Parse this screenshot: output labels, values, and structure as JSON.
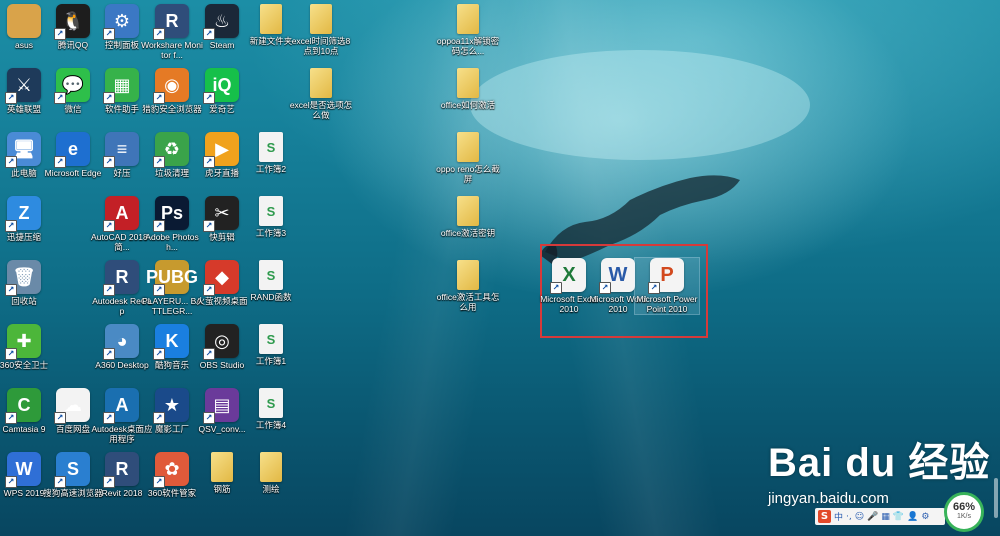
{
  "desktop": {
    "icons": [
      {
        "label": "asus",
        "glyph": "",
        "color": "#d9a34a",
        "type": "user"
      },
      {
        "label": "腾讯QQ",
        "glyph": "🐧",
        "color": "#1d1d1d",
        "type": "app"
      },
      {
        "label": "控制面板",
        "glyph": "⚙",
        "color": "#3b78c4",
        "type": "app"
      },
      {
        "label": "Workshare Monitor f...",
        "glyph": "R",
        "color": "#2f4d7a",
        "type": "app"
      },
      {
        "label": "Steam",
        "glyph": "♨",
        "color": "#1b2838",
        "type": "app"
      },
      {
        "label": "新建文件夹",
        "glyph": "",
        "color": "#e8c35a",
        "type": "folder"
      },
      {
        "label": "excel时间筛选8点到10点",
        "glyph": "",
        "color": "#e8c35a",
        "type": "folder"
      },
      {
        "label": "oppoa11x解锁密码怎么...",
        "glyph": "",
        "color": "#e8c35a",
        "type": "folder"
      },
      {
        "label": "英雄联盟",
        "glyph": "⚔",
        "color": "#1e3a5a",
        "type": "app"
      },
      {
        "label": "微信",
        "glyph": "💬",
        "color": "#2ebf4a",
        "type": "app"
      },
      {
        "label": "软件助手",
        "glyph": "▦",
        "color": "#36b24a",
        "type": "app"
      },
      {
        "label": "猎豹安全浏览器",
        "glyph": "◉",
        "color": "#e57a25",
        "type": "app"
      },
      {
        "label": "爱奇艺",
        "glyph": "iQ",
        "color": "#16c04a",
        "type": "app"
      },
      {
        "label": "excel是否选项怎么做",
        "glyph": "",
        "color": "#e8c35a",
        "type": "folder"
      },
      {
        "label": "office如何激活",
        "glyph": "",
        "color": "#e8c35a",
        "type": "folder"
      },
      {
        "label": "此电脑",
        "glyph": "🖥",
        "color": "#4a8bd6",
        "type": "app"
      },
      {
        "label": "Microsoft Edge",
        "glyph": "e",
        "color": "#1e6fd0",
        "type": "app"
      },
      {
        "label": "好压",
        "glyph": "≡",
        "color": "#3f75b8",
        "type": "app"
      },
      {
        "label": "垃圾清理",
        "glyph": "♻",
        "color": "#3aa34a",
        "type": "app"
      },
      {
        "label": "虎牙直播",
        "glyph": "▶",
        "color": "#f0a21d",
        "type": "app"
      },
      {
        "label": "工作簿2",
        "glyph": "S",
        "color": "#f3f3f3",
        "type": "sheet"
      },
      {
        "label": "oppo reno怎么截屏",
        "glyph": "",
        "color": "#e8c35a",
        "type": "folder"
      },
      {
        "label": "迅捷压缩",
        "glyph": "Z",
        "color": "#2e8be0",
        "type": "app"
      },
      {
        "label": "AutoCAD 2018 - 简...",
        "glyph": "A",
        "color": "#c32026",
        "type": "app"
      },
      {
        "label": "Adobe Photosh...",
        "glyph": "Ps",
        "color": "#0a1a33",
        "type": "app"
      },
      {
        "label": "快剪辑",
        "glyph": "✂",
        "color": "#222",
        "type": "app"
      },
      {
        "label": "工作簿3",
        "glyph": "S",
        "color": "#f3f3f3",
        "type": "sheet"
      },
      {
        "label": "office激活密钥",
        "glyph": "",
        "color": "#e8c35a",
        "type": "folder"
      },
      {
        "label": "回收站",
        "glyph": "🗑",
        "color": "#6a8aa8",
        "type": "app"
      },
      {
        "label": "Autodesk ReCap",
        "glyph": "R",
        "color": "#2f4d7a",
        "type": "app"
      },
      {
        "label": "PLAYERU... BATTLEGR...",
        "glyph": "PUBG",
        "color": "#c79a2e",
        "type": "app"
      },
      {
        "label": "火萤视频桌面",
        "glyph": "◆",
        "color": "#d63a2a",
        "type": "app"
      },
      {
        "label": "RAND函数",
        "glyph": "S",
        "color": "#f3f3f3",
        "type": "sheet"
      },
      {
        "label": "office激活工具怎么用",
        "glyph": "",
        "color": "#e8c35a",
        "type": "folder"
      },
      {
        "label": "360安全卫士",
        "glyph": "✚",
        "color": "#4cb63a",
        "type": "app"
      },
      {
        "label": "A360 Desktop",
        "glyph": "◕",
        "color": "#4a8ac4",
        "type": "app"
      },
      {
        "label": "酷狗音乐",
        "glyph": "K",
        "color": "#1a7fe0",
        "type": "app"
      },
      {
        "label": "OBS Studio",
        "glyph": "◎",
        "color": "#222",
        "type": "app"
      },
      {
        "label": "工作簿1",
        "glyph": "S",
        "color": "#f3f3f3",
        "type": "sheet"
      },
      {
        "label": "Camtasia 9",
        "glyph": "C",
        "color": "#2e9a3a",
        "type": "app"
      },
      {
        "label": "百度网盘",
        "glyph": "☁",
        "color": "#f3f3f3",
        "type": "app"
      },
      {
        "label": "Autodesk桌面应用程序",
        "glyph": "A",
        "color": "#1a6fb0",
        "type": "app"
      },
      {
        "label": "魔影工厂",
        "glyph": "★",
        "color": "#1a4a8a",
        "type": "app"
      },
      {
        "label": "QSV_conv...",
        "glyph": "▤",
        "color": "#6a3a9a",
        "type": "app"
      },
      {
        "label": "工作簿4",
        "glyph": "S",
        "color": "#f3f3f3",
        "type": "sheet"
      },
      {
        "label": "WPS 2019",
        "glyph": "W",
        "color": "#2f6fd6",
        "type": "app"
      },
      {
        "label": "搜狗高速浏览器",
        "glyph": "S",
        "color": "#2a7fd0",
        "type": "app"
      },
      {
        "label": "Revit 2018",
        "glyph": "R",
        "color": "#2f4d7a",
        "type": "app"
      },
      {
        "label": "360软件管家",
        "glyph": "✿",
        "color": "#e05a3a",
        "type": "app"
      },
      {
        "label": "钢筋",
        "glyph": "",
        "color": "#e8c35a",
        "type": "folder"
      },
      {
        "label": "测绘",
        "glyph": "",
        "color": "#e8c35a",
        "type": "folder"
      }
    ],
    "office_icons": [
      {
        "label": "Microsoft Excel 2010",
        "glyph": "X",
        "color": "#1f7a3a"
      },
      {
        "label": "Microsoft Word 2010",
        "glyph": "W",
        "color": "#2a5aa8"
      },
      {
        "label": "Microsoft PowerPoint 2010",
        "glyph": "P",
        "color": "#d2491e"
      }
    ]
  },
  "watermark": {
    "logo": "Bai du 经验",
    "url": "jingyan.baidu.com"
  },
  "tray": {
    "items": [
      "S",
      "中",
      "·,",
      "☺",
      "🎤",
      "▦",
      "👕",
      "👤",
      "⚙"
    ]
  },
  "speed_widget": {
    "percent": "66%",
    "rate": "1K/s"
  }
}
